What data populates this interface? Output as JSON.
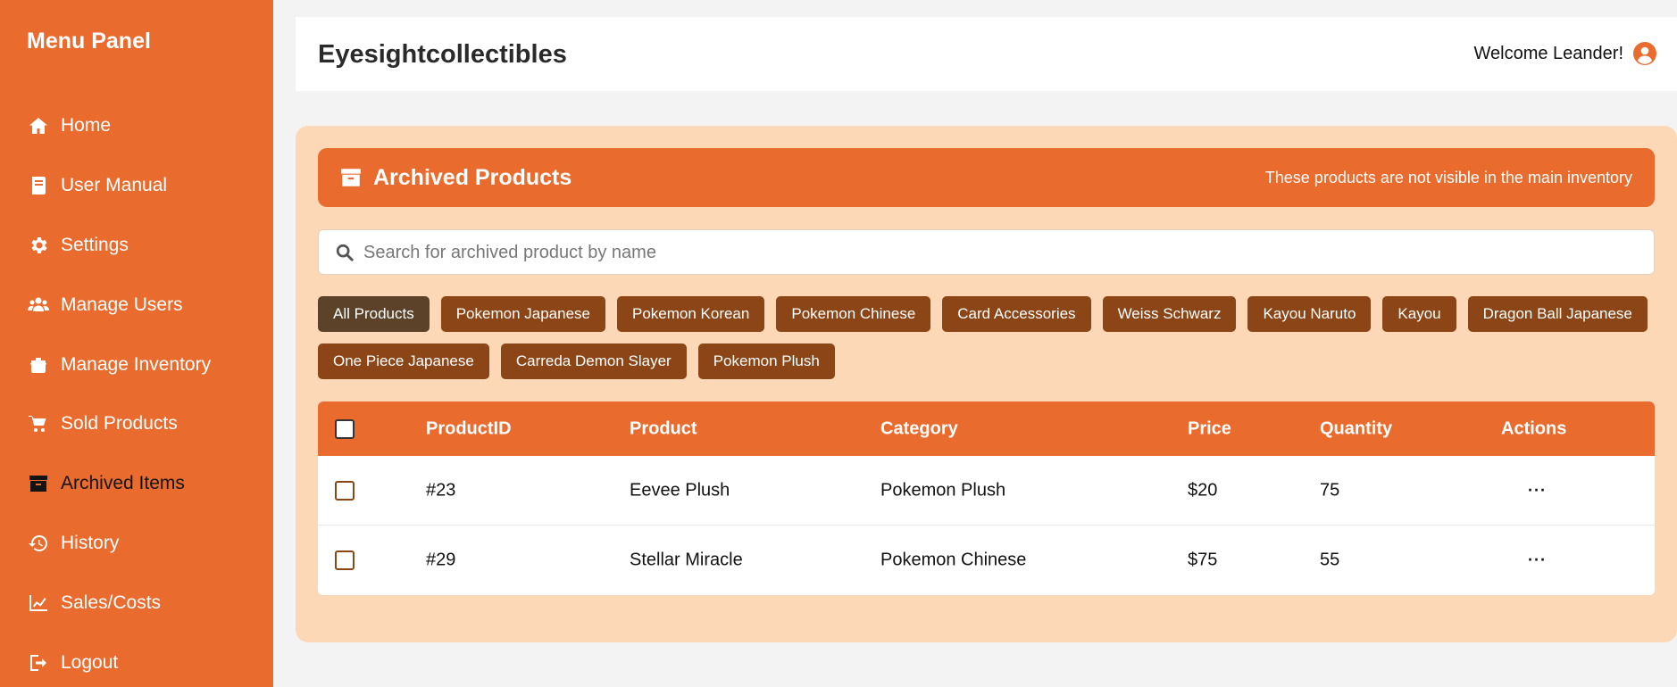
{
  "sidebar": {
    "title": "Menu Panel",
    "items": [
      {
        "label": "Home",
        "icon": "home-icon"
      },
      {
        "label": "User Manual",
        "icon": "book-icon"
      },
      {
        "label": "Settings",
        "icon": "gear-icon"
      },
      {
        "label": "Manage Users",
        "icon": "users-icon"
      },
      {
        "label": "Manage Inventory",
        "icon": "box-icon"
      },
      {
        "label": "Sold Products",
        "icon": "cart-icon"
      },
      {
        "label": "Archived Items",
        "icon": "archive-icon",
        "active": true
      },
      {
        "label": "History",
        "icon": "history-icon"
      },
      {
        "label": "Sales/Costs",
        "icon": "chart-icon"
      },
      {
        "label": "Logout",
        "icon": "logout-icon"
      }
    ]
  },
  "header": {
    "title": "Eyesightcollectibles",
    "welcome": "Welcome Leander!",
    "avatar_icon": "user-circle-icon"
  },
  "main": {
    "banner": {
      "title": "Archived Products",
      "note": "These products are not visible in the main inventory",
      "icon": "archive-icon"
    },
    "search": {
      "placeholder": "Search for archived product by name",
      "value": "",
      "icon": "search-icon"
    },
    "filters": [
      {
        "label": "All Products",
        "active": true
      },
      {
        "label": "Pokemon Japanese"
      },
      {
        "label": "Pokemon Korean"
      },
      {
        "label": "Pokemon Chinese"
      },
      {
        "label": "Card Accessories"
      },
      {
        "label": "Weiss Schwarz"
      },
      {
        "label": "Kayou Naruto"
      },
      {
        "label": "Kayou"
      },
      {
        "label": "Dragon Ball Japanese"
      },
      {
        "label": "One Piece Japanese"
      },
      {
        "label": "Carreda Demon Slayer"
      },
      {
        "label": "Pokemon Plush"
      }
    ],
    "table": {
      "columns": [
        "ProductID",
        "Product",
        "Category",
        "Price",
        "Quantity",
        "Actions"
      ],
      "rows": [
        {
          "id": "#23",
          "product": "Eevee Plush",
          "category": "Pokemon Plush",
          "price": "$20",
          "quantity": "75",
          "actions": "···"
        },
        {
          "id": "#29",
          "product": "Stellar Miracle",
          "category": "Pokemon Chinese",
          "price": "$75",
          "quantity": "55",
          "actions": "···"
        }
      ]
    }
  },
  "colors": {
    "accent": "#e96b2e",
    "panel_bg": "#fdd8b6",
    "chip": "#8b4516",
    "chip_active": "#5b4228"
  }
}
